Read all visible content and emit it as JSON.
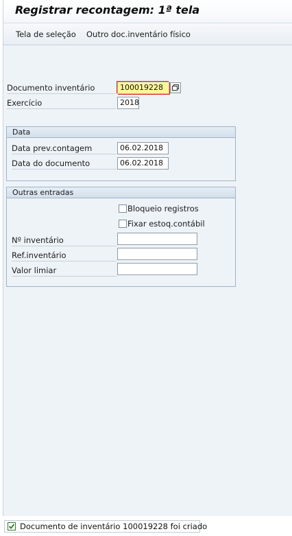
{
  "title": "Registrar recontagem: 1ª tela",
  "toolbar": {
    "selection_screen": "Tela de seleção",
    "other_doc": "Outro doc.inventário físico"
  },
  "header_fields": {
    "doc_label": "Documento inventário",
    "doc_value": "100019228",
    "year_label": "Exercício",
    "year_value": "2018"
  },
  "group_data": {
    "title": "Data",
    "plan_count_label": "Data prev.contagem",
    "plan_count_value": "06.02.2018",
    "doc_date_label": "Data do documento",
    "doc_date_value": "06.02.2018"
  },
  "group_other": {
    "title": "Outras entradas",
    "block_label": "Bloqueio registros",
    "block_checked": false,
    "freeze_label": "Fixar estoq.contábil",
    "freeze_checked": false,
    "inv_no_label": "Nº inventário",
    "inv_no_value": "",
    "inv_ref_label": "Ref.inventário",
    "inv_ref_value": "",
    "threshold_label": "Valor limiar",
    "threshold_value": ""
  },
  "status": {
    "message": "Documento de inventário 100019228 foi criado",
    "type": "success",
    "icon": "success-check-icon",
    "color": "#2d7a2d"
  }
}
